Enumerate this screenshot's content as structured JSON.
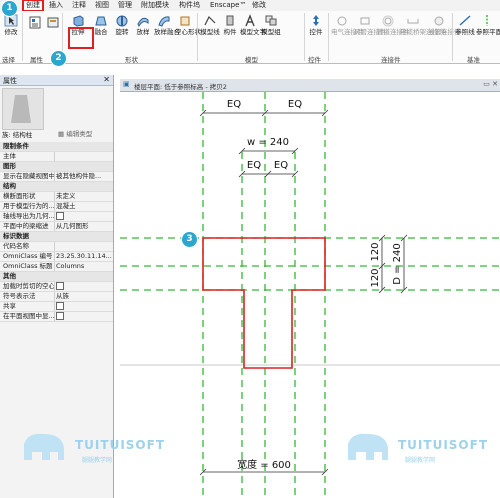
{
  "badges": {
    "one": "1",
    "two": "2",
    "three": "3"
  },
  "menu": {
    "items": [
      "创建",
      "插入",
      "注释",
      "视图",
      "管理",
      "附加模块",
      "构件坞",
      "Enscape™",
      "修改"
    ]
  },
  "ribbon": {
    "modify": "修改",
    "form_buttons": [
      "拉伸",
      "融合",
      "旋转",
      "放样",
      "放样融合",
      "空心形状"
    ],
    "model_buttons": [
      "模型线",
      "构件",
      "模型文字",
      "模型组"
    ],
    "control": "控件",
    "connector_buttons": [
      "电气连接件",
      "风管连接件",
      "管道连接件",
      "电缆桥架连接件",
      "线管连接件"
    ],
    "datum_buttons": [
      "参照线",
      "参照平面"
    ],
    "groups": {
      "select": "选择",
      "properties": "属性",
      "form": "形状",
      "model": "模型",
      "control": "控件",
      "connector": "连接件",
      "datum": "基准"
    }
  },
  "properties": {
    "title": "属性",
    "family_label": "族: 结构柱",
    "edit_type": "编辑类型",
    "rows": [
      {
        "kind": "cat",
        "key": "限制条件"
      },
      {
        "kind": "row",
        "key": "主体",
        "value": ""
      },
      {
        "kind": "cat",
        "key": "图形"
      },
      {
        "kind": "row",
        "key": "显示在隐藏视图中",
        "value": "被其他构件隐..."
      },
      {
        "kind": "cat",
        "key": "结构"
      },
      {
        "kind": "row",
        "key": "横断面形状",
        "value": "未定义"
      },
      {
        "kind": "row",
        "key": "用于模型行为的...",
        "value": "混凝土"
      },
      {
        "kind": "row",
        "key": "轴线导出为几何...",
        "value": "",
        "check": true
      },
      {
        "kind": "row",
        "key": "平面中的梁缩进",
        "value": "从几何图形"
      },
      {
        "kind": "cat",
        "key": "标识数据"
      },
      {
        "kind": "row",
        "key": "代码名称",
        "value": ""
      },
      {
        "kind": "row",
        "key": "OmniClass 编号",
        "value": "23.25.30.11.14..."
      },
      {
        "kind": "row",
        "key": "OmniClass 标题",
        "value": "Columns"
      },
      {
        "kind": "cat",
        "key": "其他"
      },
      {
        "kind": "row",
        "key": "加载时剪切的空心",
        "value": "",
        "check": true
      },
      {
        "kind": "row",
        "key": "符号表示法",
        "value": "从族"
      },
      {
        "kind": "row",
        "key": "共享",
        "value": "",
        "check": true
      },
      {
        "kind": "row",
        "key": "在平面视图中显...",
        "value": "",
        "check": true
      }
    ]
  },
  "view": {
    "title": "楼层平面: 低于参照标高 - 拷贝2",
    "dims": {
      "eq": "EQ",
      "w": "w = 240",
      "d": "D = 240",
      "h120": "120",
      "width": "宽度 = 600"
    }
  },
  "watermark": {
    "text": "TUITUISOFT",
    "sub": "腿腿教学网"
  },
  "colors": {
    "ref_line": "#33bb33",
    "sketch": "#e02020",
    "marker": "#2aa6cf"
  }
}
